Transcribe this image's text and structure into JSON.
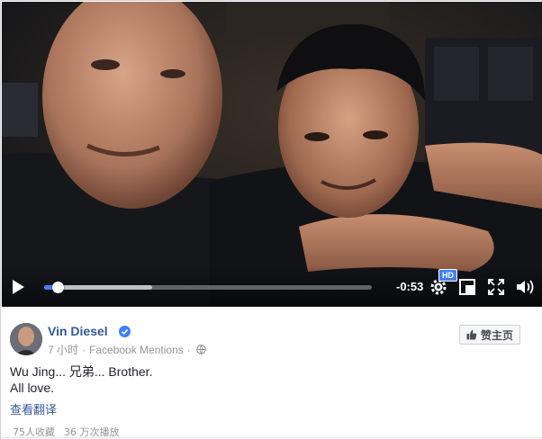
{
  "video": {
    "time_remaining": "-0:53",
    "progress": 0.04,
    "buffered": 0.33,
    "hd_label": "HD",
    "icons": [
      "play-icon",
      "settings-gear-icon",
      "picture-in-picture-icon",
      "fullscreen-icon",
      "volume-icon"
    ]
  },
  "post": {
    "author": "Vin Diesel",
    "time": "7 小时",
    "separator": "·",
    "mentions": "Facebook Mentions",
    "like_page_label": "赞主页",
    "text_line1": "Wu Jing... 兄弟... Brother.",
    "text_line2": "All love.",
    "translate_label": "查看翻译",
    "saves": "75人收藏",
    "views": "36 万次播放"
  },
  "colors": {
    "link": "#365899",
    "accent": "#4080ff",
    "meta": "#90949c"
  }
}
